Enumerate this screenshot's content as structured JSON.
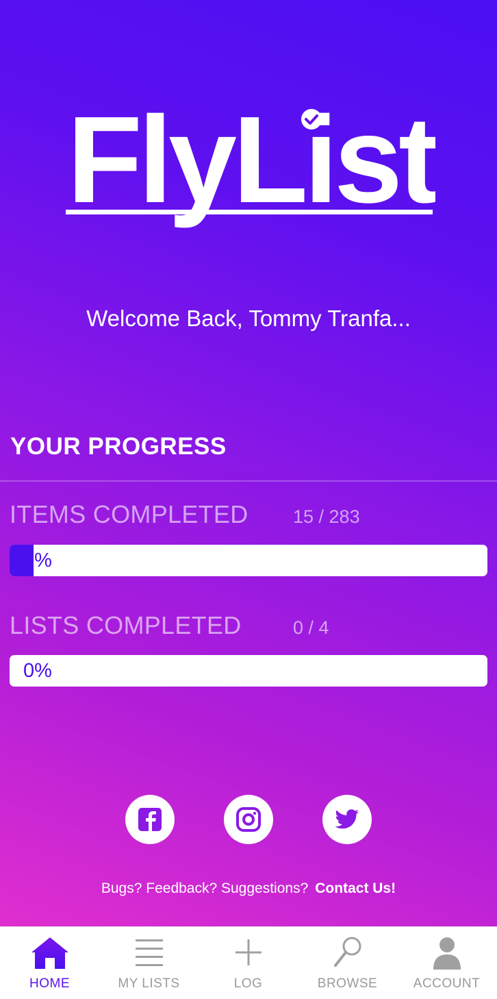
{
  "app": {
    "name": "FlyList"
  },
  "welcome": {
    "text": "Welcome Back, Tommy Tranfa..."
  },
  "progress": {
    "title": "YOUR PROGRESS",
    "items": {
      "label": "ITEMS COMPLETED",
      "count": "15 / 283",
      "percent_label": "5%",
      "fraction": 0.05
    },
    "lists": {
      "label": "LISTS COMPLETED",
      "count": "0 / 4",
      "percent_label": "0%",
      "fraction": 0.0
    }
  },
  "social": {
    "icons": [
      "facebook-icon",
      "instagram-icon",
      "twitter-icon"
    ]
  },
  "footer": {
    "prompt": "Bugs? Feedback? Suggestions?",
    "contact_link": "Contact Us!"
  },
  "tabs": {
    "home": "HOME",
    "my_lists": "MY LISTS",
    "log": "LOG",
    "browse": "BROWSE",
    "account": "ACCOUNT",
    "active": "HOME"
  },
  "colors": {
    "accent": "#4a10ee",
    "gradient_top": "#4a0ff2",
    "gradient_bottom": "#e02fcf",
    "tab_inactive": "#9a9a9a"
  }
}
